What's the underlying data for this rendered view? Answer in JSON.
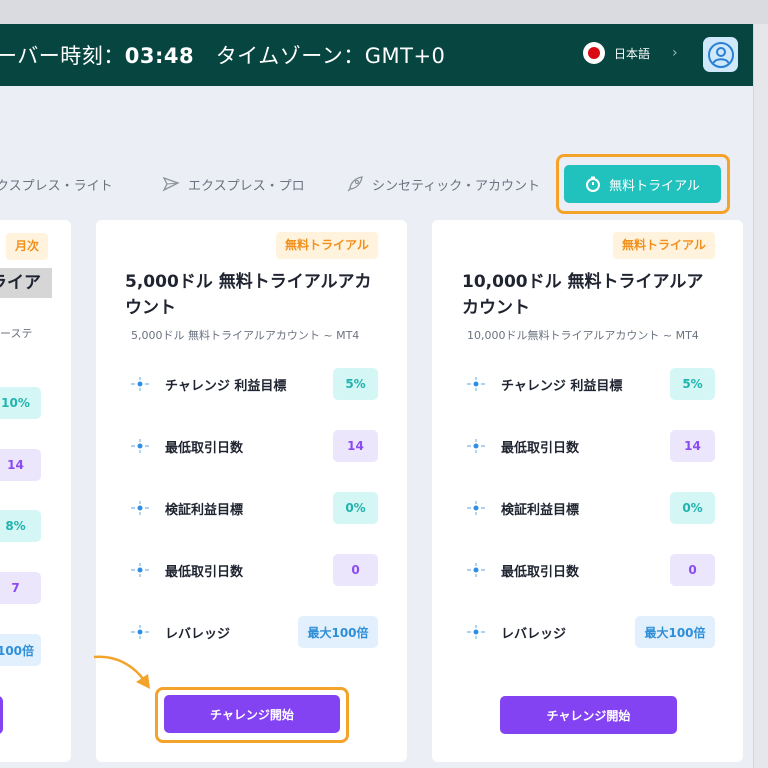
{
  "header": {
    "server_time_label": "ーバー時刻：",
    "server_time": "03:48",
    "timezone_label": "タイムゾーン：",
    "timezone": "GMT+0",
    "language": "日本語",
    "lang_arrow": "›"
  },
  "tabs": [
    {
      "label": "クスプレス・ライト"
    },
    {
      "label": "エクスプレス・プロ"
    },
    {
      "label": "シンセティック・アカウント"
    }
  ],
  "active_tab": {
    "label": "無料トライアル"
  },
  "partial_card": {
    "badge": "月次",
    "title_fragment": "ライア",
    "sub_fragment": "ーステ",
    "values": [
      "10%",
      "14",
      "8%",
      "7",
      "100倍"
    ]
  },
  "cards": [
    {
      "badge": "無料トライアル",
      "title": "5,000ドル 無料トライアルアカウント",
      "subtitle": "5,000ドル 無料トライアルアカウント ~ MT4",
      "rows": [
        {
          "label": "チャレンジ 利益目標",
          "value": "5%"
        },
        {
          "label": "最低取引日数",
          "value": "14"
        },
        {
          "label": "検証利益目標",
          "value": "0%"
        },
        {
          "label": "最低取引日数",
          "value": "0"
        },
        {
          "label": "レバレッジ",
          "value": "最大100倍"
        }
      ],
      "button": "チャレンジ開始"
    },
    {
      "badge": "無料トライアル",
      "title": "10,000ドル 無料トライアルアカウント",
      "subtitle": "10,000ドル無料トライアルアカウント ~ MT4",
      "rows": [
        {
          "label": "チャレンジ 利益目標",
          "value": "5%"
        },
        {
          "label": "最低取引日数",
          "value": "14"
        },
        {
          "label": "検証利益目標",
          "value": "0%"
        },
        {
          "label": "最低取引日数",
          "value": "0"
        },
        {
          "label": "レバレッジ",
          "value": "最大100倍"
        }
      ],
      "button": "チャレンジ開始"
    }
  ],
  "colors": {
    "header_bg": "#074640",
    "accent_teal": "#21c2bd",
    "accent_purple": "#8443f2",
    "highlight_orange": "#f4a32a"
  }
}
